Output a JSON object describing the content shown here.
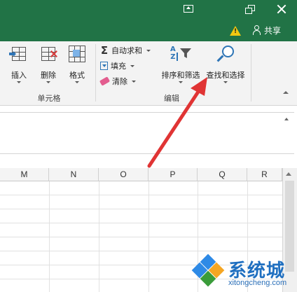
{
  "ribbon": {
    "cells_group": {
      "label": "单元格",
      "insert": "插入",
      "delete": "删除",
      "format": "格式"
    },
    "editing_group": {
      "label": "编辑",
      "autosum": "自动求和",
      "fill": "填充",
      "clear": "清除",
      "sort_filter": "排序和筛选",
      "find_select": "查找和选择"
    }
  },
  "titlebar": {
    "share": "共享"
  },
  "sheet": {
    "columns": [
      "M",
      "N",
      "O",
      "P",
      "Q",
      "R"
    ]
  },
  "watermark": {
    "text": "系统城",
    "url": "xitongcheng.com"
  },
  "colors": {
    "title_bar": "#217346",
    "annotation_arrow": "#e03434",
    "accent_blue": "#2e75b6"
  }
}
